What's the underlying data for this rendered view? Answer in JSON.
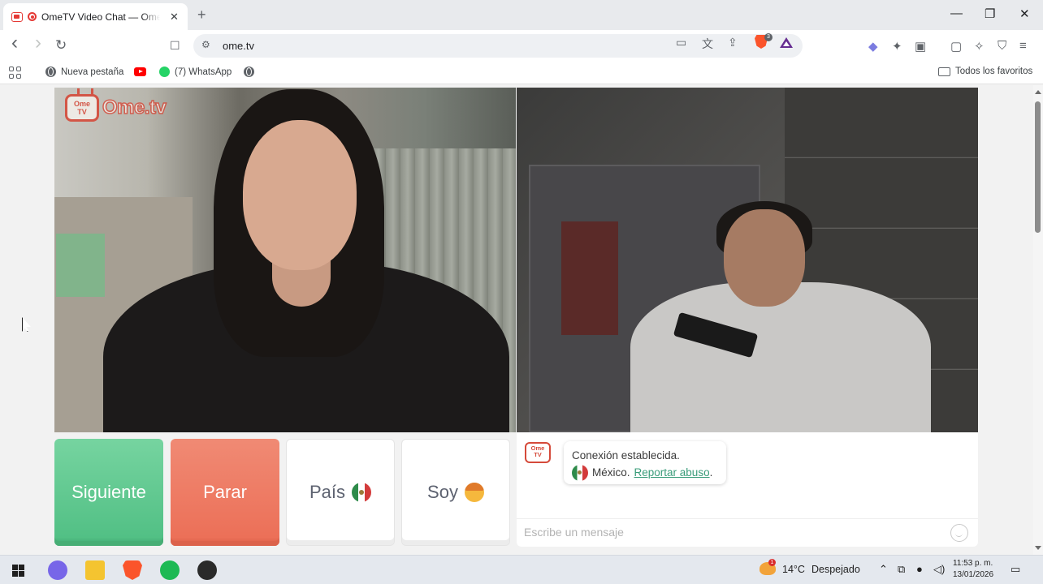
{
  "browser": {
    "tab": {
      "title": "OmeTV Video Chat — Omegle",
      "close": "✕"
    },
    "new_tab": "+",
    "window": {
      "minimize": "—",
      "restore": "❐",
      "close": "✕"
    },
    "nav": {
      "back": "‹",
      "forward": "›",
      "reload": "↻"
    },
    "address": "ome.tv",
    "shield_badge": "3",
    "bookmarks": [
      {
        "label": "Nueva pestaña",
        "icon": "globe-icon"
      },
      {
        "label": "",
        "icon": "youtube-icon"
      },
      {
        "label": "(7) WhatsApp",
        "icon": "whatsapp-icon"
      },
      {
        "label": "",
        "icon": "globe-icon"
      }
    ],
    "all_bookmarks": "Todos los favoritos"
  },
  "page": {
    "logo": {
      "badge": "Ome TV",
      "word": "Ome.tv"
    },
    "buttons": {
      "next": "Siguiente",
      "stop": "Parar",
      "country": "País",
      "gender": "Soy"
    },
    "chat": {
      "tv_badge": "Ome TV",
      "status": "Conexión establecida.",
      "country": "México.",
      "report": "Reportar abuso",
      "report_suffix": ".",
      "placeholder": "Escribe un mensaje"
    }
  },
  "taskbar": {
    "weather": {
      "temp": "14°C",
      "condition": "Despejado",
      "badge": "1"
    },
    "clock": {
      "time": "11:53 p. m.",
      "date": "13/01/2026"
    }
  },
  "colors": {
    "next_green": "#5cc98c",
    "stop_red": "#ee7a63",
    "report_link": "#3a9c7a",
    "ome_red": "#d54a3a"
  }
}
